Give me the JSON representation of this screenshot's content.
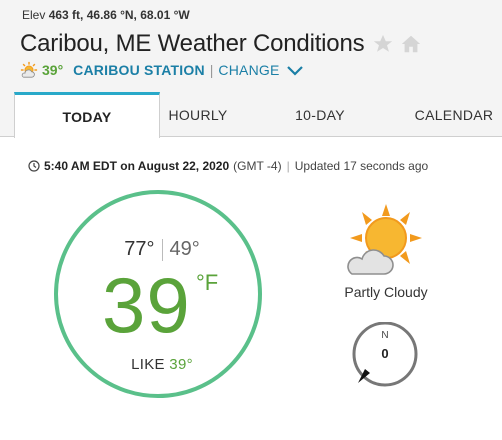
{
  "location": {
    "elev_label": "Elev",
    "elev_value": "463 ft,",
    "lat": "46.86 °N,",
    "lon": "68.01 °W",
    "title": "Caribou, ME Weather Conditions"
  },
  "current": {
    "summary_temp": "39°",
    "station": "CARIBOU STATION",
    "divider": "|",
    "change": "CHANGE"
  },
  "tabs": [
    {
      "label": "TODAY",
      "active": true
    },
    {
      "label": "HOURLY",
      "active": false
    },
    {
      "label": "10-DAY",
      "active": false
    },
    {
      "label": "CALENDAR",
      "active": false
    }
  ],
  "timestamp": {
    "time": "5:40 AM EDT on August 22, 2020",
    "tz": "(GMT -4)",
    "sep": "|",
    "updated": "Updated 17 seconds ago"
  },
  "conditions": {
    "high": "77°",
    "low": "49°",
    "temp": "39",
    "unit": "°F",
    "like_label": "LIKE",
    "like_value": "39°",
    "condition": "Partly Cloudy",
    "wind_dir": "N",
    "wind_speed": "0"
  },
  "icons": {
    "header_star": "star-icon",
    "header_home": "home-icon",
    "station_weather": "partly-cloudy-icon",
    "dropdown": "chevron-down-icon",
    "clock": "clock-icon",
    "main_weather": "partly-cloudy-icon",
    "wind": "wind-compass-icon"
  },
  "colors": {
    "accent_green": "#5aa33a",
    "ring": "#5ac08a",
    "link_blue": "#1b7fa6",
    "tab_active_border": "#29a9c9",
    "sun": "#f29a1d"
  }
}
